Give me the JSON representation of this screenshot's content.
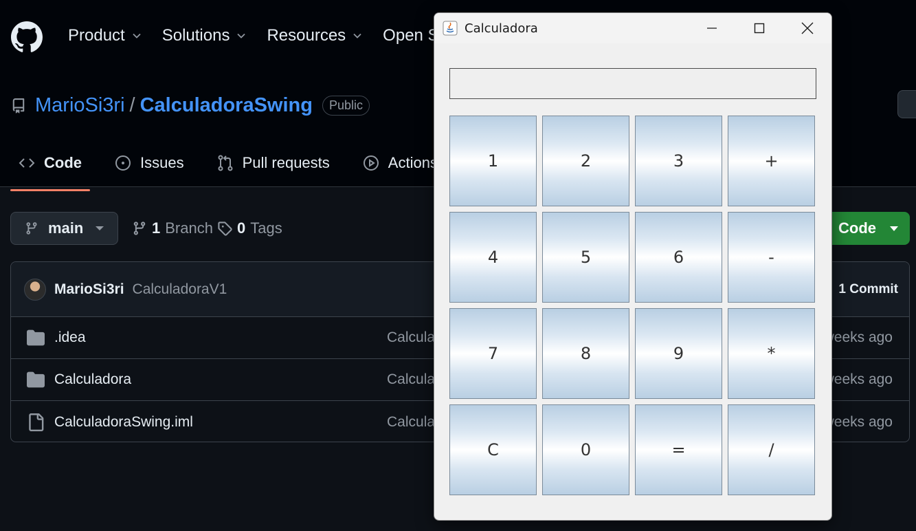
{
  "github": {
    "nav": [
      "Product",
      "Solutions",
      "Resources",
      "Open So"
    ],
    "repo": {
      "owner": "MarioSi3ri",
      "slash": "/",
      "name": "CalculadoraSwing",
      "visibility": "Public"
    },
    "tabs": [
      {
        "label": "Code",
        "icon": "code-icon"
      },
      {
        "label": "Issues",
        "icon": "issue-icon"
      },
      {
        "label": "Pull requests",
        "icon": "pull-request-icon"
      },
      {
        "label": "Actions",
        "icon": "play-icon"
      }
    ],
    "branch": {
      "name": "main",
      "branches_count": "1",
      "branches_label": "Branch",
      "tags_count": "0",
      "tags_label": "Tags"
    },
    "code_button": "Code",
    "latest_commit": {
      "user": "MarioSi3ri",
      "message": "CalculadoraV1",
      "count": "1 Commit"
    },
    "files": [
      {
        "name": ".idea",
        "type": "folder",
        "commit": "Calcula",
        "age": "weeks ago"
      },
      {
        "name": "Calculadora",
        "type": "folder",
        "commit": "Calcula",
        "age": "weeks ago"
      },
      {
        "name": "CalculadoraSwing.iml",
        "type": "file",
        "commit": "Calcula",
        "age": "weeks ago"
      }
    ],
    "colors": {
      "accent_link": "#4493f8",
      "tab_underline": "#f78166",
      "green_button": "#238636"
    }
  },
  "calculator": {
    "title": "Calculadora",
    "display_value": "",
    "keys": [
      "1",
      "2",
      "3",
      "+",
      "4",
      "5",
      "6",
      "-",
      "7",
      "8",
      "9",
      "*",
      "C",
      "0",
      "=",
      "/"
    ]
  }
}
